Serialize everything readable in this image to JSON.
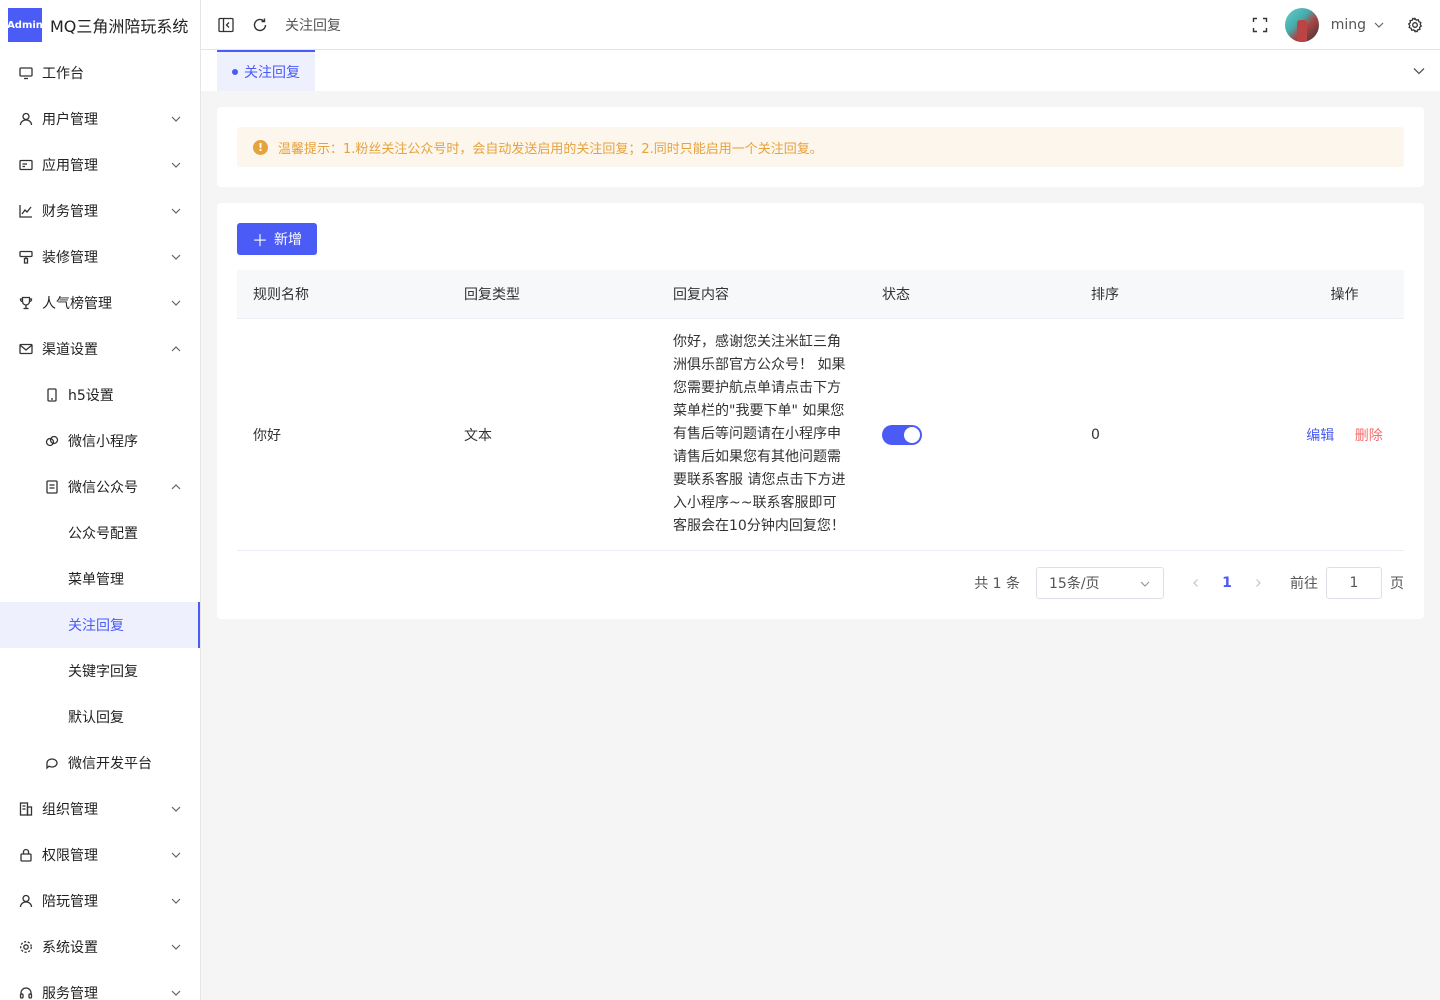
{
  "app": {
    "badge": "Admin",
    "title": "MQ三角洲陪玩系统"
  },
  "sidebar": {
    "items": [
      {
        "label": "工作台",
        "icon": "monitor-icon"
      },
      {
        "label": "用户管理",
        "icon": "user-icon"
      },
      {
        "label": "应用管理",
        "icon": "app-icon"
      },
      {
        "label": "财务管理",
        "icon": "chart-icon"
      },
      {
        "label": "装修管理",
        "icon": "brush-icon"
      },
      {
        "label": "人气榜管理",
        "icon": "trophy-icon"
      },
      {
        "label": "渠道设置",
        "icon": "mail-icon"
      },
      {
        "label": "h5设置",
        "icon": "mobile-icon"
      },
      {
        "label": "微信小程序",
        "icon": "miniprogram-icon"
      },
      {
        "label": "微信公众号",
        "icon": "document-icon"
      },
      {
        "label": "公众号配置"
      },
      {
        "label": "菜单管理"
      },
      {
        "label": "关注回复"
      },
      {
        "label": "关键字回复"
      },
      {
        "label": "默认回复"
      },
      {
        "label": "微信开发平台",
        "icon": "chat-icon"
      },
      {
        "label": "组织管理",
        "icon": "building-icon"
      },
      {
        "label": "权限管理",
        "icon": "lock-icon"
      },
      {
        "label": "陪玩管理",
        "icon": "user-icon"
      },
      {
        "label": "系统设置",
        "icon": "gear-icon"
      },
      {
        "label": "服务管理",
        "icon": "headset-icon"
      }
    ]
  },
  "header": {
    "breadcrumb": "关注回复",
    "username": "ming"
  },
  "tabs": [
    {
      "label": "关注回复"
    }
  ],
  "tip": {
    "text": "温馨提示：1.粉丝关注公众号时，会自动发送启用的关注回复；2.同时只能启用一个关注回复。"
  },
  "toolbar": {
    "add_label": "新增"
  },
  "table": {
    "columns": [
      "规则名称",
      "回复类型",
      "回复内容",
      "状态",
      "排序",
      "操作"
    ],
    "rows": [
      {
        "name": "你好",
        "type": "文本",
        "content": "你好，感谢您关注米缸三角洲俱乐部官方公众号！ 如果您需要护航点单请点击下方菜单栏的\"我要下单\" 如果您有售后等问题请在小程序申请售后如果您有其他问题需要联系客服 请您点击下方进入小程序~~联系客服即可客服会在10分钟内回复您！",
        "status_on": true,
        "sort": "0",
        "edit_label": "编辑",
        "delete_label": "删除"
      }
    ]
  },
  "pagination": {
    "total": "共 1 条",
    "page_size": "15条/页",
    "current_page": "1",
    "goto_label": "前往",
    "goto_value": "1",
    "page_suffix": "页"
  },
  "colors": {
    "accent": "#4a5bf6",
    "warning": "#e6a23c",
    "danger": "#f56c6c"
  }
}
